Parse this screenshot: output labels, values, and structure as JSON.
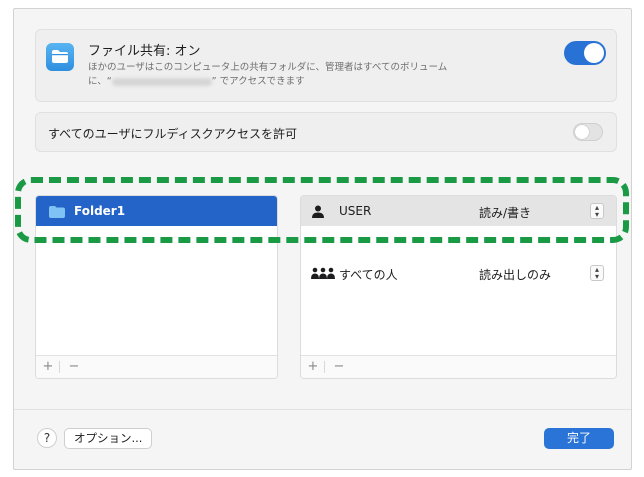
{
  "file_sharing": {
    "title": "ファイル共有: オン",
    "description_line1": "ほかのユーザはこのコンピュータ上の共有フォルダに、管理者はすべてのボリューム",
    "description_prefix": "に、“",
    "description_suffix": "” でアクセスできます",
    "toggle_state": "on"
  },
  "full_disk_access": {
    "label": "すべてのユーザにフルディスクアクセスを許可",
    "toggle_state": "off"
  },
  "shared_folders": {
    "items": [
      {
        "label": "Folder1",
        "selected": true
      }
    ],
    "add_label": "+",
    "remove_label": "−"
  },
  "users": {
    "items": [
      {
        "name": "USER",
        "permission": "読み/書き",
        "icon": "person-icon"
      },
      {
        "name": "すべての人",
        "permission": "読み出しのみ",
        "icon": "group-icon"
      }
    ],
    "add_label": "+",
    "remove_label": "−"
  },
  "footer": {
    "help_label": "?",
    "options_label": "オプション...",
    "done_label": "完了"
  },
  "colors": {
    "accent": "#2a74d8",
    "selection": "#2463c7",
    "annotation": "#1b9a45"
  }
}
